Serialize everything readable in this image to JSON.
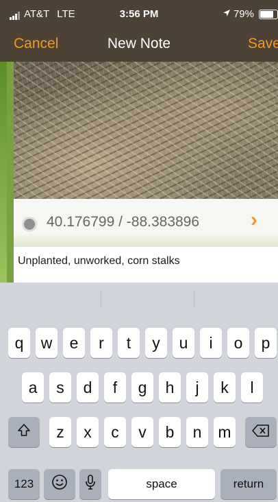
{
  "status_bar": {
    "carrier": "AT&T",
    "network": "LTE",
    "time": "3:56 PM",
    "battery": "79%"
  },
  "nav": {
    "cancel": "Cancel",
    "title": "New Note",
    "save": "Save"
  },
  "location": {
    "coordinates": "40.176799 / -88.383896"
  },
  "note": {
    "text": "Unplanted, unworked, corn stalks"
  },
  "keyboard": {
    "row1": [
      "q",
      "w",
      "e",
      "r",
      "t",
      "y",
      "u",
      "i",
      "o",
      "p"
    ],
    "row2": [
      "a",
      "s",
      "d",
      "f",
      "g",
      "h",
      "j",
      "k",
      "l"
    ],
    "row3": [
      "z",
      "x",
      "c",
      "v",
      "b",
      "n",
      "m"
    ],
    "numbers": "123",
    "space": "space",
    "return": "return",
    "icons": {
      "shift": "shift-icon",
      "backspace": "backspace-icon",
      "emoji": "emoji-icon",
      "mic": "microphone-icon"
    }
  },
  "colors": {
    "accent": "#f39a1e",
    "bar": "#4d4236"
  }
}
